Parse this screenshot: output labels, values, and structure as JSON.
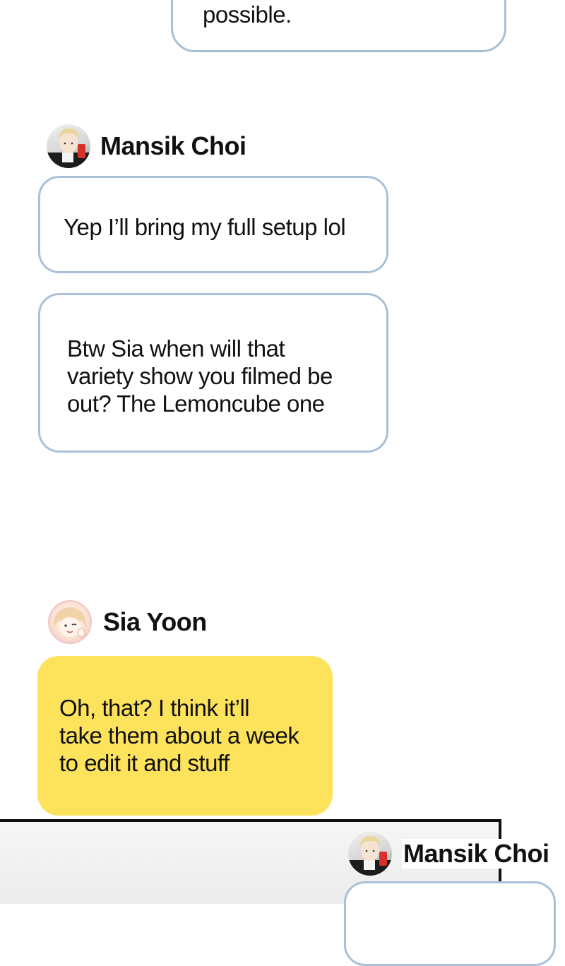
{
  "messages": [
    {
      "text": "possible."
    },
    {
      "sender": "Mansik Choi",
      "text": "Yep I’ll bring my full setup lol"
    },
    {
      "text_lines": [
        "Btw Sia when will that",
        "variety show you filmed be",
        "out? The Lemoncube one"
      ]
    },
    {
      "sender": "Sia Yoon",
      "text_lines": [
        "Oh, that? I think it’ll",
        "take them about a week",
        "to edit it and stuff"
      ]
    },
    {
      "sender": "Mansik Choi"
    }
  ],
  "colors": {
    "bubble_border": "#a9c0d8",
    "highlight_bubble": "#fde25b",
    "background": "#ffffff"
  },
  "icons": {
    "avatar_mansik": "avatar-mansik-icon",
    "avatar_sia": "avatar-sia-icon"
  }
}
